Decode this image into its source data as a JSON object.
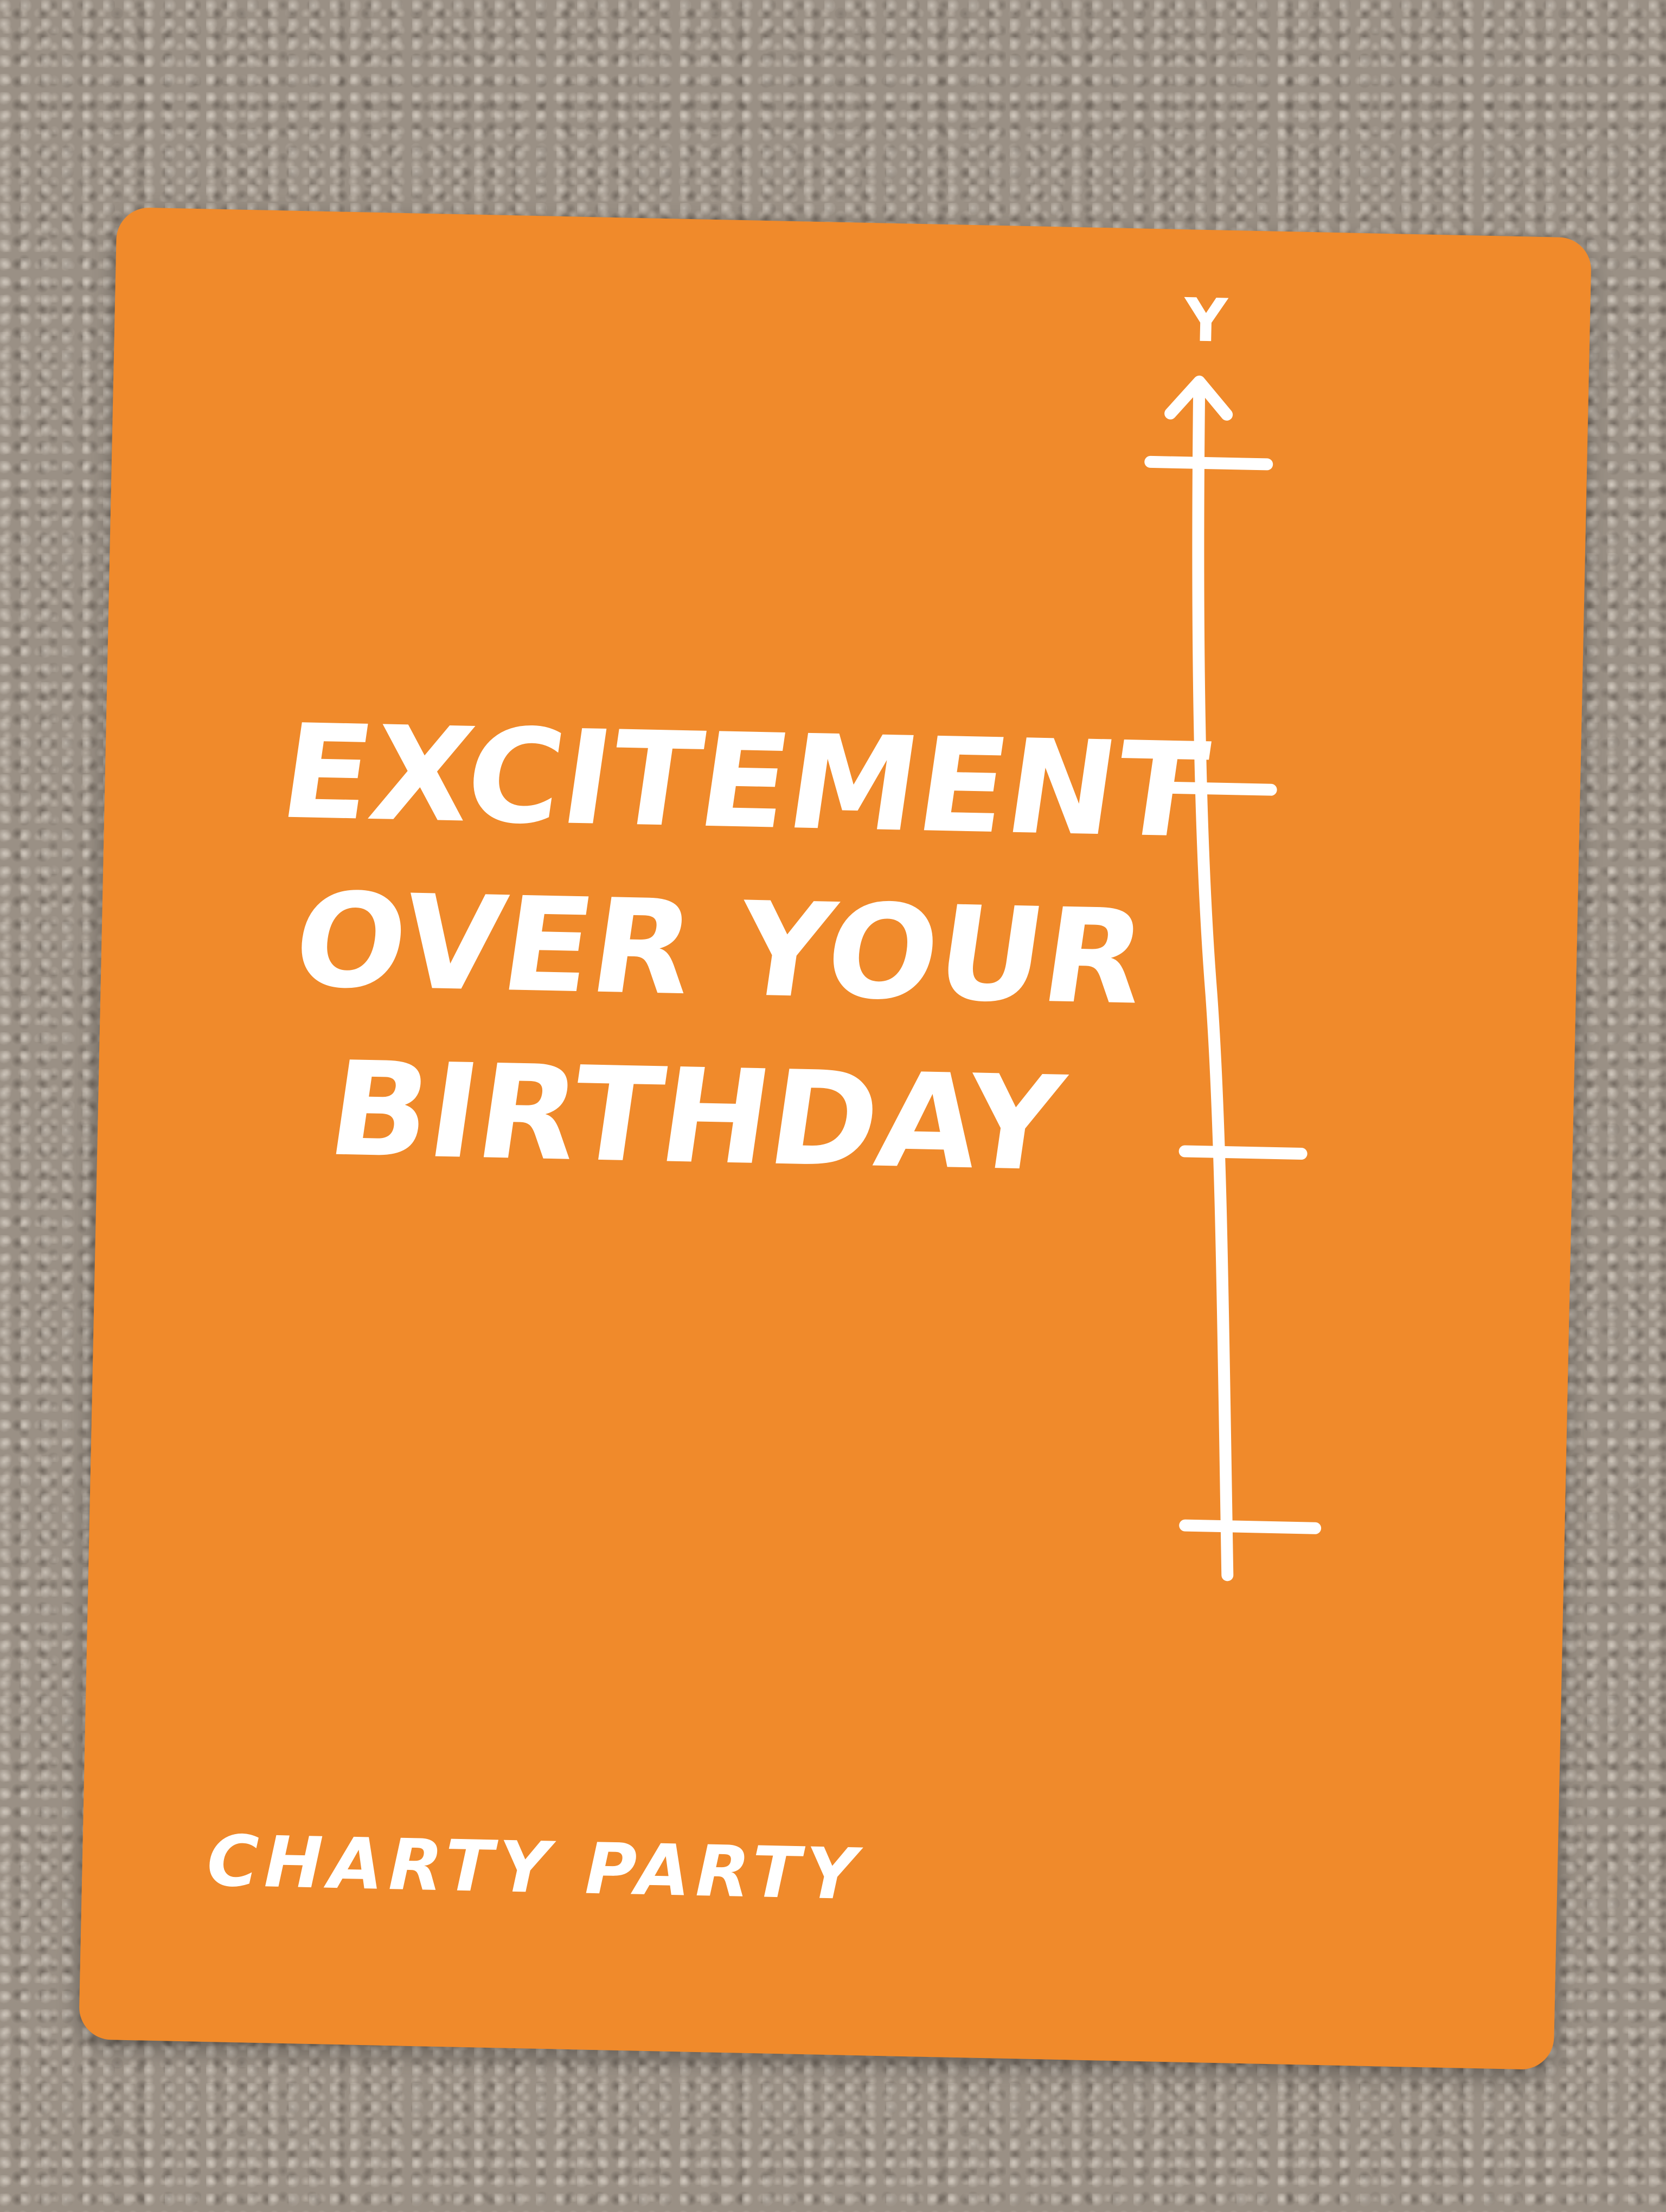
{
  "card": {
    "title_lines": [
      "EXCITEMENT",
      "OVER YOUR",
      "BIRTHDAY"
    ],
    "brand": "CHARTY PARTY",
    "axis_label": "Y",
    "background_color": "#f08a2b",
    "text_color": "#ffffff"
  }
}
